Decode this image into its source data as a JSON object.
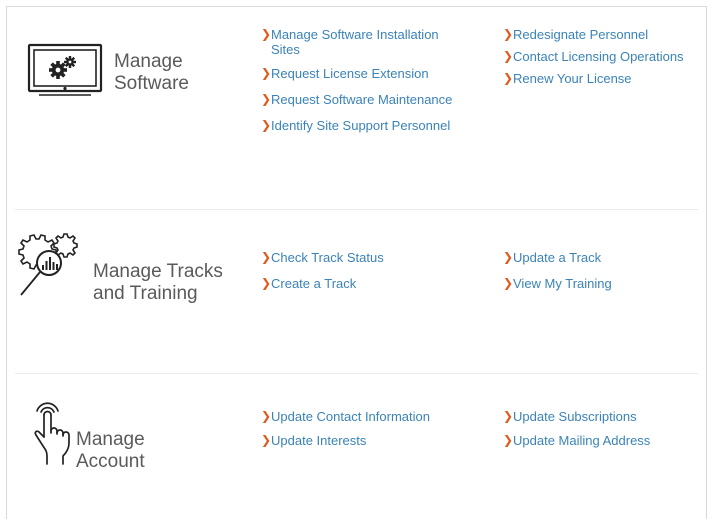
{
  "sections": [
    {
      "title_line1": "Manage",
      "title_line2": "Software",
      "icon": "monitor-gears-icon",
      "links_left": [
        "Manage Software Installation Sites",
        "Request License Extension",
        "Request Software Maintenance",
        "Identify Site Support Personnel"
      ],
      "links_right": [
        "Redesignate Personnel",
        "Contact Licensing Operations",
        "Renew Your License"
      ]
    },
    {
      "title_line1": "Manage Tracks",
      "title_line2": "and Training",
      "icon": "gears-magnifier-chart-icon",
      "links_left": [
        "Check Track Status",
        "Create a Track"
      ],
      "links_right": [
        "Update a Track",
        "View My Training"
      ]
    },
    {
      "title_line1": "Manage",
      "title_line2": "Account",
      "icon": "pointing-hand-icon",
      "links_left": [
        "Update Contact Information",
        "Update Interests"
      ],
      "links_right": [
        "Update Subscriptions",
        "Update Mailing Address"
      ]
    }
  ],
  "colors": {
    "link": "#3a83b8",
    "chevron": "#e2581a",
    "title": "#5a5a5a"
  }
}
